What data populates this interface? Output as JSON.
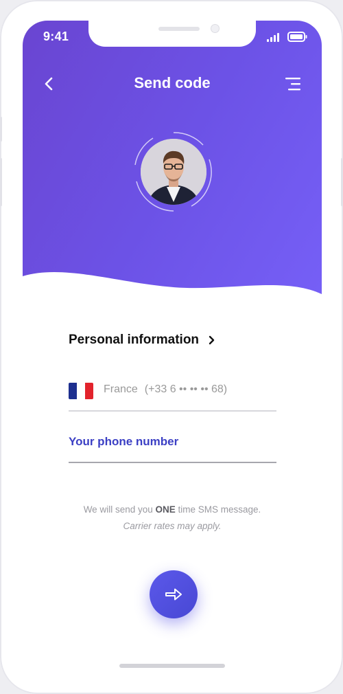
{
  "status_bar": {
    "time": "9:41"
  },
  "header": {
    "title": "Send code",
    "back_icon": "chevron-left-icon",
    "menu_icon": "menu-icon",
    "gradient": [
      "#6a45d1",
      "#7660f7"
    ]
  },
  "profile": {
    "avatar_icon": "user-avatar"
  },
  "personal_info": {
    "title": "Personal information",
    "chevron": "›"
  },
  "country": {
    "name": "France",
    "code_hint": "(+33 6 •• •• •• 68)",
    "flag_colors": [
      "#1d2f8f",
      "#ffffff",
      "#e2232c"
    ]
  },
  "phone_field": {
    "placeholder": "Your phone number",
    "value": ""
  },
  "note": {
    "line1_prefix": "We will send you ",
    "line1_bold": "ONE",
    "line1_suffix": " time SMS message.",
    "line2": "Carrier rates may apply."
  },
  "colors": {
    "accent": "#3b3fc4",
    "button": "#5453e2"
  }
}
